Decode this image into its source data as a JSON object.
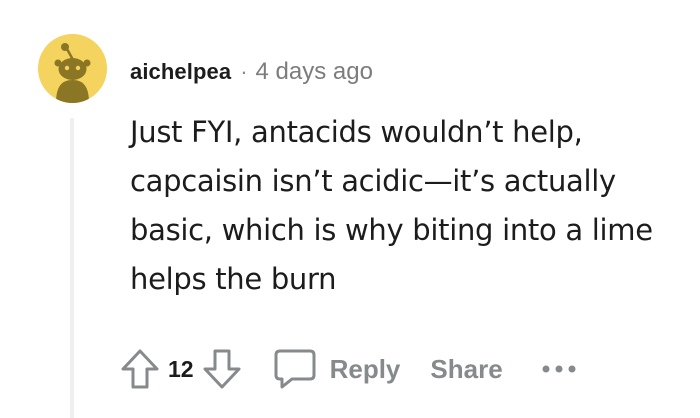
{
  "comment": {
    "author": "aichelpea",
    "separator": "·",
    "timestamp": "4 days ago",
    "body": "Just FYI, antacids wouldn’t help, capcaisin isn’t acidic—it’s actually basic, which is why biting into a lime helps the burn",
    "vote_count": "12"
  },
  "actions": {
    "reply_label": "Reply",
    "share_label": "Share",
    "more_label": "•••"
  },
  "icons": {
    "avatar": "reddit-snoo-avatar",
    "upvote": "arrow-up-outline-icon",
    "downvote": "arrow-down-outline-icon",
    "reply": "speech-bubble-icon",
    "more": "ellipsis-icon"
  },
  "colors": {
    "avatar_bg": "#f4d35e",
    "avatar_figure": "#8a7624",
    "text_primary": "#1c1c1c",
    "text_muted": "#878a8c",
    "thread_line": "#edeff1"
  }
}
